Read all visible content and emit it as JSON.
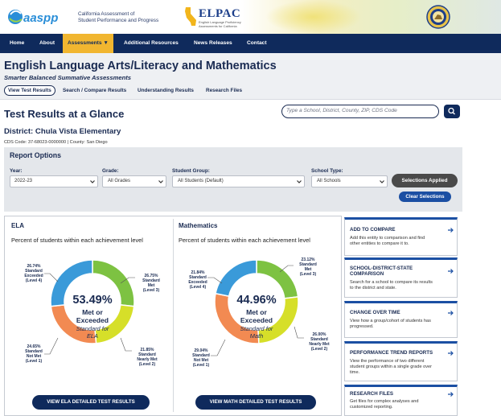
{
  "header": {
    "caaspp_logo": "CAASPP",
    "caaspp_tagline_line1": "California Assessment of",
    "caaspp_tagline_line2": "Student Performance and Progress",
    "elpac_logo": "ELPAC",
    "elpac_tagline": "English Language Proficiency Assessments for California",
    "seal": "California Department of Education seal"
  },
  "nav": {
    "items": [
      "Home",
      "About",
      "Assessments ▼",
      "Additional Resources",
      "News Releases",
      "Contact"
    ],
    "active_index": 2
  },
  "page": {
    "title": "English Language Arts/Literacy and Mathematics",
    "subtitle": "Smarter Balanced Summative Assessments",
    "subtabs": [
      "View Test Results",
      "Search / Compare Results",
      "Understanding Results",
      "Research Files"
    ],
    "active_subtab": 0
  },
  "glance": {
    "title": "Test Results at a Glance",
    "search_placeholder": "Type a School, District, County, ZIP, CDS Code",
    "district": "District: Chula Vista Elementary",
    "codes": "CDS Code: 37-68023-0000000  |  County: San Diego"
  },
  "report_options": {
    "title": "Report Options",
    "year_label": "Year:",
    "year_value": "2022-23",
    "grade_label": "Grade:",
    "grade_value": "All Grades",
    "group_label": "Student Group:",
    "group_value": "All Students (Default)",
    "school_type_label": "School Type:",
    "school_type_value": "All Schools",
    "applied_button": "Selections Applied",
    "clear_button": "Clear Selections"
  },
  "ela": {
    "heading": "ELA",
    "description": "Percent of students within each achievement level",
    "center_pct": "53.49%",
    "center_line1": "Met or",
    "center_line2": "Exceeded",
    "center_line3": "Standard for",
    "center_line4": "ELA",
    "detail_button": "VIEW ELA DETAILED TEST RESULTS"
  },
  "math": {
    "heading": "Mathematics",
    "description": "Percent of students within each achievement level",
    "center_pct": "44.96%",
    "center_line1": "Met or",
    "center_line2": "Exceeded",
    "center_line3": "Standard for",
    "center_line4": "Math",
    "detail_button": "VIEW MATH DETAILED TEST RESULTS"
  },
  "chart_data": [
    {
      "type": "pie",
      "title": "ELA",
      "categories": [
        "Standard Exceeded (Level 4)",
        "Standard Met (Level 3)",
        "Standard Nearly Met (Level 2)",
        "Standard Not Met (Level 1)"
      ],
      "values": [
        26.74,
        26.75,
        21.85,
        24.65
      ],
      "labels": [
        {
          "pct": "26.74%",
          "l1": "Standard",
          "l2": "Exceeded",
          "l3": "(Level 4)"
        },
        {
          "pct": "26.75%",
          "l1": "Standard",
          "l2": "Met",
          "l3": "(Level 3)"
        },
        {
          "pct": "21.85%",
          "l1": "Standard",
          "l2": "Nearly Met",
          "l3": "(Level 2)"
        },
        {
          "pct": "24.65%",
          "l1": "Standard",
          "l2": "Not Met",
          "l3": "(Level 1)"
        }
      ],
      "colors": [
        "#3a9ad9",
        "#7dc242",
        "#d6df29",
        "#f28a52"
      ]
    },
    {
      "type": "pie",
      "title": "Mathematics",
      "categories": [
        "Standard Exceeded (Level 4)",
        "Standard Met (Level 3)",
        "Standard Nearly Met (Level 2)",
        "Standard Not Met (Level 1)"
      ],
      "values": [
        21.84,
        23.12,
        26.0,
        29.04
      ],
      "labels": [
        {
          "pct": "21.84%",
          "l1": "Standard",
          "l2": "Exceeded",
          "l3": "(Level 4)"
        },
        {
          "pct": "23.12%",
          "l1": "Standard",
          "l2": "Met",
          "l3": "(Level 3)"
        },
        {
          "pct": "26.00%",
          "l1": "Standard",
          "l2": "Nearly Met",
          "l3": "(Level 2)"
        },
        {
          "pct": "29.04%",
          "l1": "Standard",
          "l2": "Not Met",
          "l3": "(Level 1)"
        }
      ],
      "colors": [
        "#3a9ad9",
        "#7dc242",
        "#d6df29",
        "#f28a52"
      ]
    }
  ],
  "cards": [
    {
      "title": "ADD TO COMPARE",
      "desc": [
        "Add this entity to comparison and find",
        "other entities to compare it to."
      ]
    },
    {
      "title": "SCHOOL-DISTRICT-STATE",
      "title2": "COMPARISON",
      "desc": [
        "Search for a school to compare its results",
        "to the district and state."
      ]
    },
    {
      "title": "CHANGE OVER TIME",
      "desc": [
        "View how a group/cohort of students has",
        "progressed."
      ]
    },
    {
      "title": "PERFORMANCE TREND REPORTS",
      "desc": [
        "View the performance of two different",
        "student groups within a single grade over",
        "time."
      ]
    },
    {
      "title": "RESEARCH FILES",
      "desc": [
        "Get files for complex analyses and",
        "customized reporting."
      ]
    }
  ]
}
